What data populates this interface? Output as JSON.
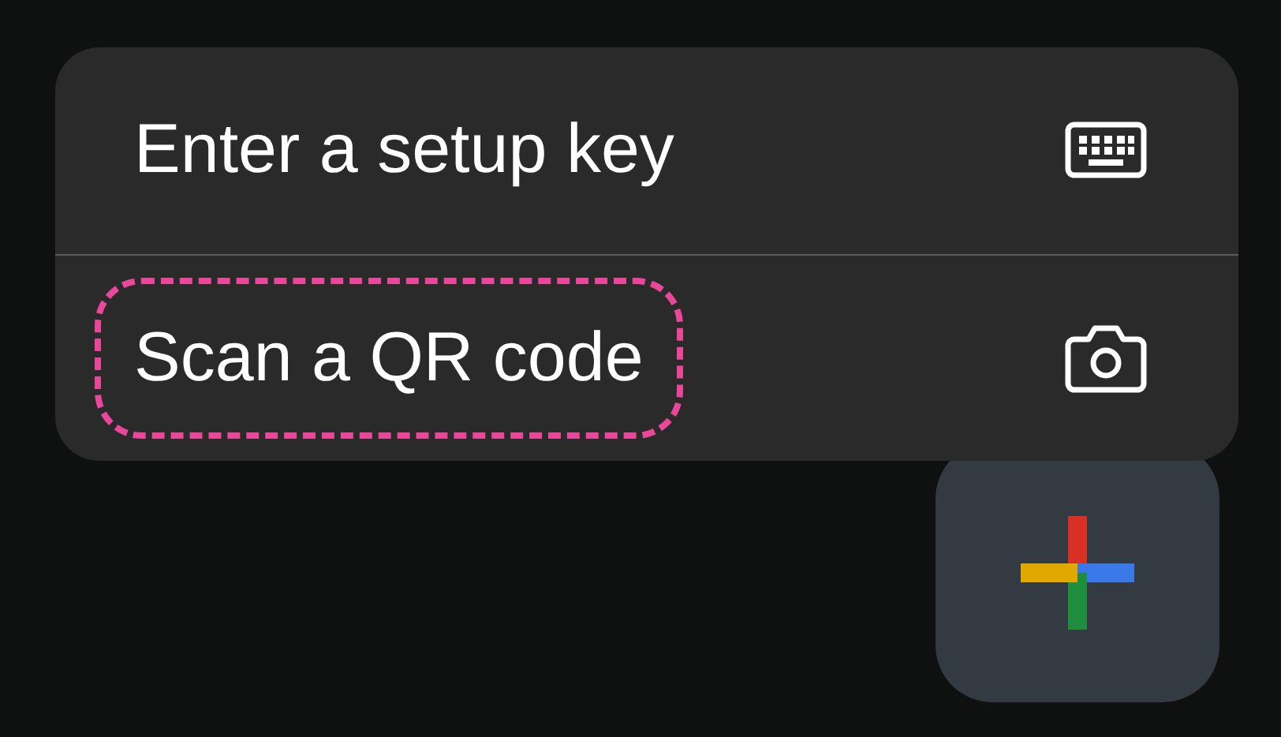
{
  "menu": {
    "items": [
      {
        "label": "Enter a setup key",
        "highlighted": false
      },
      {
        "label": "Scan a QR code",
        "highlighted": true
      }
    ]
  }
}
